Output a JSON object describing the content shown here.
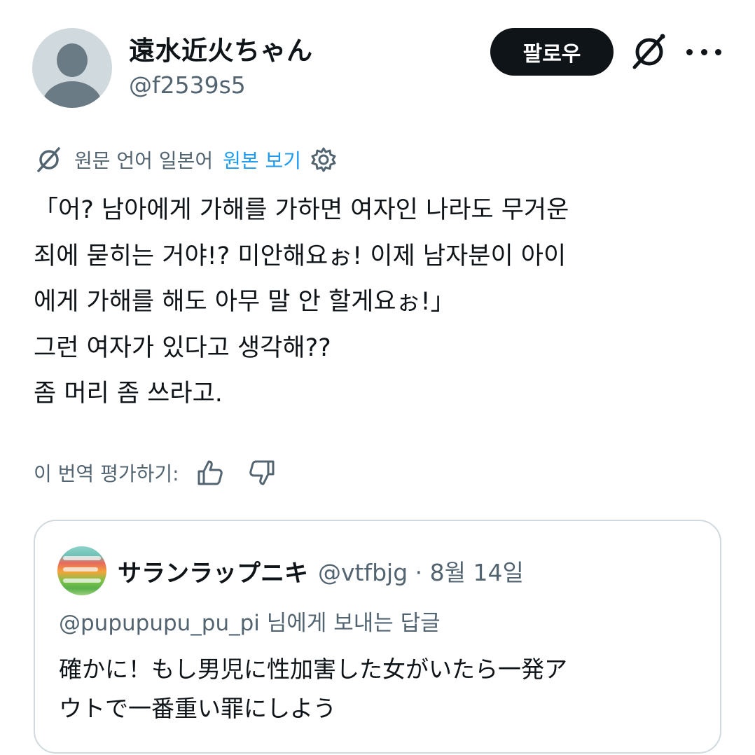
{
  "author": {
    "display_name": "遠水近火ちゃん",
    "handle": "@f2539s5"
  },
  "header_actions": {
    "follow_label": "팔로우",
    "more_icon": "more-horizontal-icon",
    "grok_icon": "grok-slash-icon"
  },
  "translation": {
    "source_language": "원문 언어 일본어",
    "view_original_label": "원본 보기",
    "settings_icon": "gear-icon"
  },
  "tweet": {
    "lines": [
      "「어? 남아에게 가해를 가하면 여자인 나라도 무거운",
      "죄에 묻히는 거야!? 미안해요ぉ! 이제 남자분이 아이",
      "에게 가해를 해도 아무 말 안 할게요ぉ!」",
      "그런 여자가 있다고 생각해??",
      "좀 머리 좀 쓰라고."
    ]
  },
  "rating": {
    "label": "이 번역 평가하기:",
    "thumbs_up_icon": "thumbs-up-icon",
    "thumbs_down_icon": "thumbs-down-icon"
  },
  "quoted_tweet": {
    "display_name": "サランラップニキ",
    "handle_date": "@vtfbjg · 8월 14일",
    "reply_mention": "@pupupupu_pu_pi",
    "reply_suffix": " 님에게 보내는 답글",
    "lines": [
      "確かに！もし男児に性加害した女がいたら一発ア",
      "ウトで一番重い罪にしよう"
    ]
  },
  "colors": {
    "text_primary": "#0f1419",
    "text_secondary": "#536471",
    "link": "#1d9bf0",
    "border": "#cfd9de",
    "button_bg": "#0f1419"
  }
}
